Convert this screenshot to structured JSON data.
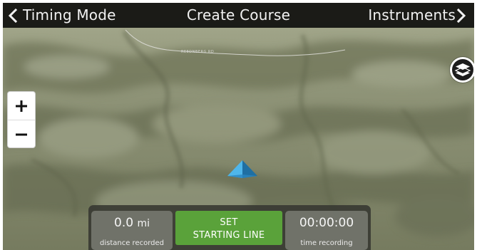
{
  "topbar": {
    "back_label": "Timing Mode",
    "title": "Create Course",
    "forward_label": "Instruments"
  },
  "map": {
    "road_label": "REEDNBERG RD",
    "zoom_in_symbol": "+",
    "zoom_out_symbol": "−",
    "layers_icon": "layers-icon",
    "position_icon": "location-arrow-icon"
  },
  "panel": {
    "distance_value": "0.0",
    "distance_unit": "mi",
    "distance_label": "distance recorded",
    "set_line1": "SET",
    "set_line2": "STARTING LINE",
    "time_value": "00:00:00",
    "time_label": "time recording"
  },
  "colors": {
    "topbar_bg": "#10100e",
    "terrain_base": "#7f8468",
    "set_button": "#5aa23a",
    "panel_bg": "#373932",
    "stat_bg": "#74766e",
    "marker": "#3a9fd6"
  }
}
